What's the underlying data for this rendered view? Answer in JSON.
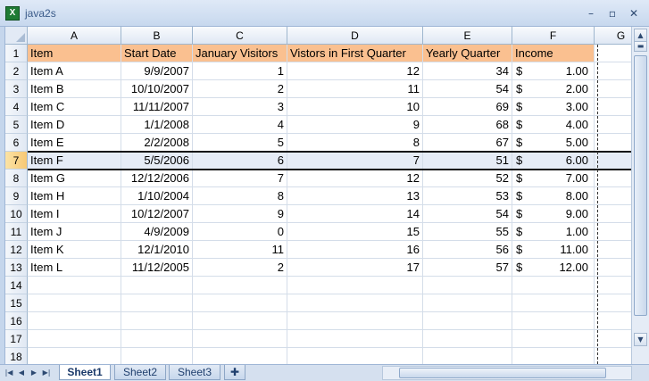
{
  "window": {
    "title": "java2s",
    "app_icon": "excel-icon",
    "buttons": {
      "minimize": "–",
      "maximize": "▫",
      "close": "✕"
    }
  },
  "sheet": {
    "columns": [
      "A",
      "B",
      "C",
      "D",
      "E",
      "F",
      "G"
    ],
    "selected_row": 7,
    "rows": [
      "1",
      "2",
      "3",
      "4",
      "5",
      "6",
      "7",
      "8",
      "9",
      "10",
      "11",
      "12",
      "13",
      "14",
      "15",
      "16",
      "17",
      "18"
    ],
    "header_fill": "#fac090",
    "headers": [
      "Item",
      "Start Date",
      "January Visitors",
      "Vistors in First Quarter",
      "Yearly Quarter",
      "Income"
    ],
    "data": [
      [
        "Item A",
        "9/9/2007",
        "1",
        "12",
        "34",
        "$",
        "1.00"
      ],
      [
        "Item B",
        "10/10/2007",
        "2",
        "11",
        "54",
        "$",
        "2.00"
      ],
      [
        "Item C",
        "11/11/2007",
        "3",
        "10",
        "69",
        "$",
        "3.00"
      ],
      [
        "Item D",
        "1/1/2008",
        "4",
        "9",
        "68",
        "$",
        "4.00"
      ],
      [
        "Item E",
        "2/2/2008",
        "5",
        "8",
        "67",
        "$",
        "5.00"
      ],
      [
        "Item F",
        "5/5/2006",
        "6",
        "7",
        "51",
        "$",
        "6.00"
      ],
      [
        "Item G",
        "12/12/2006",
        "7",
        "12",
        "52",
        "$",
        "7.00"
      ],
      [
        "Item H",
        "1/10/2004",
        "8",
        "13",
        "53",
        "$",
        "8.00"
      ],
      [
        "Item I",
        "10/12/2007",
        "9",
        "14",
        "54",
        "$",
        "9.00"
      ],
      [
        "Item J",
        "4/9/2009",
        "0",
        "15",
        "55",
        "$",
        "1.00"
      ],
      [
        "Item K",
        "12/1/2010",
        "11",
        "16",
        "56",
        "$",
        "11.00"
      ],
      [
        "Item L",
        "11/12/2005",
        "2",
        "17",
        "57",
        "$",
        "12.00"
      ]
    ]
  },
  "tabs": {
    "sheets": [
      "Sheet1",
      "Sheet2",
      "Sheet3"
    ],
    "active": "Sheet1",
    "insert_icon": "insert-sheet-icon",
    "nav_icons": [
      "first-sheet-icon",
      "prev-sheet-icon",
      "next-sheet-icon",
      "last-sheet-icon"
    ]
  }
}
